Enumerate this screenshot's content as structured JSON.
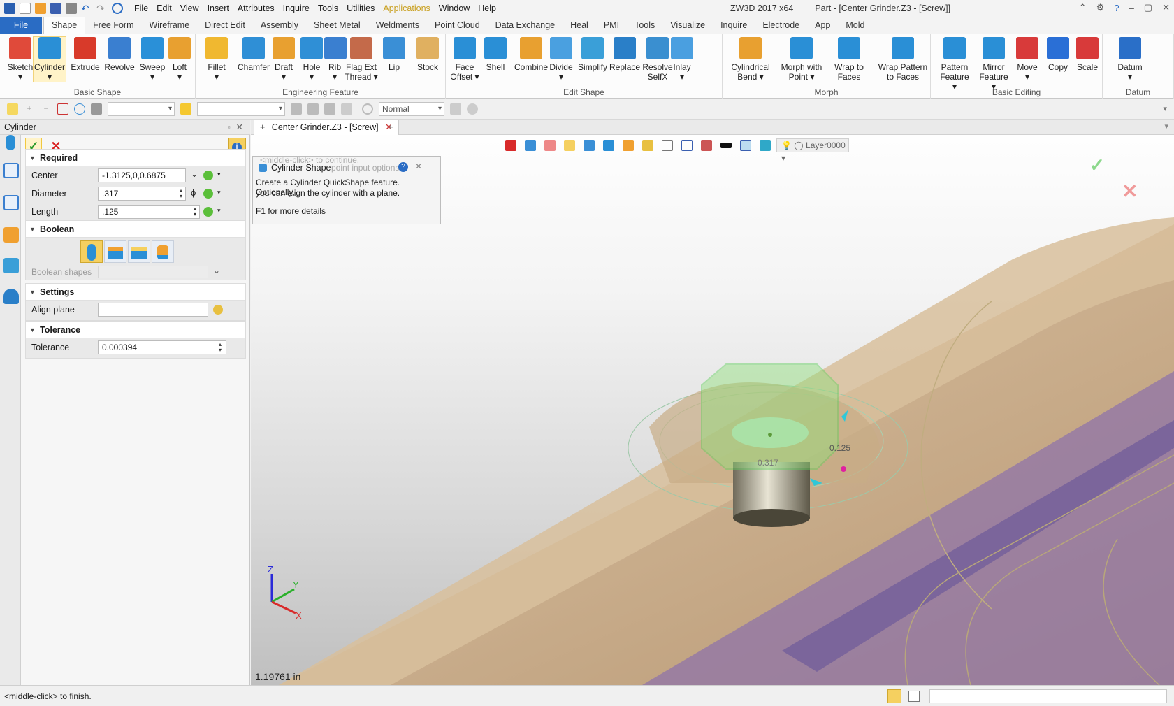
{
  "app": {
    "title": "ZW3D 2017  x64",
    "document_title": "Part - [Center Grinder.Z3 - [Screw]]"
  },
  "menu": [
    "File",
    "Edit",
    "View",
    "Insert",
    "Attributes",
    "Inquire",
    "Tools",
    "Utilities",
    "Applications",
    "Window",
    "Help"
  ],
  "ribbon_tabs": [
    "File",
    "Shape",
    "Free Form",
    "Wireframe",
    "Direct Edit",
    "Assembly",
    "Sheet Metal",
    "Weldments",
    "Point Cloud",
    "Data Exchange",
    "Heal",
    "PMI",
    "Tools",
    "Visualize",
    "Inquire",
    "Electrode",
    "App",
    "Mold"
  ],
  "ribbon_groups": [
    {
      "label": "Basic Shape",
      "buttons": [
        {
          "l1": "Sketch",
          "l2": "▾",
          "icon": "sketch-icon",
          "color": "#e04a3a"
        },
        {
          "l1": "Cylinder",
          "l2": "▾",
          "icon": "cylinder-icon",
          "color": "#2a8fd6"
        },
        {
          "l1": "Extrude",
          "l2": "",
          "icon": "extrude-icon",
          "color": "#d83a2a"
        },
        {
          "l1": "Revolve",
          "l2": "",
          "icon": "revolve-icon",
          "color": "#3a7fd0"
        },
        {
          "l1": "Sweep",
          "l2": "▾",
          "icon": "sweep-icon",
          "color": "#2a90d8"
        },
        {
          "l1": "Loft",
          "l2": "▾",
          "icon": "loft-icon",
          "color": "#e8a030"
        }
      ]
    },
    {
      "label": "Engineering Feature",
      "buttons": [
        {
          "l1": "Fillet",
          "l2": "▾",
          "icon": "fillet-icon",
          "color": "#f0b830"
        },
        {
          "l1": "Chamfer",
          "l2": "",
          "icon": "chamfer-icon",
          "color": "#2f8fd6"
        },
        {
          "l1": "Draft",
          "l2": "▾",
          "icon": "draft-icon",
          "color": "#e8a030"
        },
        {
          "l1": "Hole",
          "l2": "▾",
          "icon": "hole-icon",
          "color": "#2f8fd6"
        },
        {
          "l1": "Rib",
          "l2": "▾",
          "icon": "rib-icon",
          "color": "#3a7fd0"
        },
        {
          "l1": "Flag Ext",
          "l2": "Thread ▾",
          "icon": "thread-icon",
          "color": "#c46a4a"
        },
        {
          "l1": "Lip",
          "l2": "",
          "icon": "lip-icon",
          "color": "#3a8fd6"
        },
        {
          "l1": "Stock",
          "l2": "",
          "icon": "stock-icon",
          "color": "#e0b060"
        }
      ]
    },
    {
      "label": "Edit Shape",
      "buttons": [
        {
          "l1": "Face",
          "l2": "Offset ▾",
          "icon": "face-offset-icon",
          "color": "#2a8fd6"
        },
        {
          "l1": "Shell",
          "l2": "",
          "icon": "shell-icon",
          "color": "#2a8fd6"
        },
        {
          "l1": "Combine",
          "l2": "",
          "icon": "combine-icon",
          "color": "#e8a030"
        },
        {
          "l1": "Divide",
          "l2": "▾",
          "icon": "divide-icon",
          "color": "#4aa0e0"
        },
        {
          "l1": "Simplify",
          "l2": "",
          "icon": "simplify-icon",
          "color": "#3a9fd8"
        },
        {
          "l1": "Replace",
          "l2": "",
          "icon": "replace-icon",
          "color": "#2a7fc8"
        },
        {
          "l1": "Resolve",
          "l2": "SelfX",
          "icon": "resolve-selfx-icon",
          "color": "#3a8fd0"
        },
        {
          "l1": "Inlay",
          "l2": "▾",
          "icon": "inlay-icon",
          "color": "#4a9fe0"
        }
      ]
    },
    {
      "label": "Morph",
      "buttons": [
        {
          "l1": "Cylindrical",
          "l2": "Bend ▾",
          "icon": "cylindrical-bend-icon",
          "color": "#e8a030"
        },
        {
          "l1": "Morph with",
          "l2": "Point ▾",
          "icon": "morph-point-icon",
          "color": "#2a8fd6"
        },
        {
          "l1": "Wrap to",
          "l2": "Faces",
          "icon": "wrap-faces-icon",
          "color": "#2a8fd6"
        },
        {
          "l1": "Wrap Pattern",
          "l2": "to Faces",
          "icon": "wrap-pattern-icon",
          "color": "#2a8fd6"
        }
      ]
    },
    {
      "label": "Basic Editing",
      "buttons": [
        {
          "l1": "Pattern",
          "l2": "Feature ▾",
          "icon": "pattern-icon",
          "color": "#2a8fd6"
        },
        {
          "l1": "Mirror",
          "l2": "Feature ▾",
          "icon": "mirror-icon",
          "color": "#2a8fd6"
        },
        {
          "l1": "Move",
          "l2": "▾",
          "icon": "move-icon",
          "color": "#d83a3a"
        },
        {
          "l1": "Copy",
          "l2": "",
          "icon": "copy-icon",
          "color": "#2a6fd6"
        },
        {
          "l1": "Scale",
          "l2": "",
          "icon": "scale-icon",
          "color": "#d83a3a"
        }
      ]
    },
    {
      "label": "Datum",
      "buttons": [
        {
          "l1": "Datum",
          "l2": "▾",
          "icon": "datum-icon",
          "color": "#2a6fc8"
        }
      ]
    }
  ],
  "toolbar2": {
    "display_mode": "Normal"
  },
  "panel": {
    "title": "Cylinder",
    "required": {
      "header": "Required",
      "center_label": "Center",
      "center_value": "-1.3125,0,0.6875",
      "diameter_label": "Diameter",
      "diameter_value": ".317",
      "diameter_symbol": "ϕ",
      "length_label": "Length",
      "length_value": ".125"
    },
    "boolean": {
      "header": "Boolean",
      "shapes_label": "Boolean shapes"
    },
    "settings": {
      "header": "Settings",
      "align_label": "Align plane",
      "align_value": ""
    },
    "tolerance": {
      "header": "Tolerance",
      "label": "Tolerance",
      "value": "0.000394"
    }
  },
  "viewport": {
    "tab_label": "Center Grinder.Z3 - [Screw]",
    "layer": "Layer0000",
    "tooltip_title": "Cylinder Shape",
    "tooltip_ghost_1": "<middle-click> to continue.",
    "tooltip_ghost_2": "point input options",
    "tooltip_text_1": "Create a Cylinder QuickShape feature.  Optionally,",
    "tooltip_text_2": "you can align the cylinder with a plane.",
    "tooltip_f1": "F1 for more details",
    "dim_diameter": "0.317",
    "dim_length": "0.125",
    "measure": "1.19761 in",
    "axis_x": "X",
    "axis_y": "Y",
    "axis_z": "Z"
  },
  "status": {
    "message": "<middle-click> to finish."
  },
  "colors": {
    "accent": "#2a6cc4",
    "highlight": "#fff3c8",
    "part_body": "#c9a983",
    "part_shadow": "#8a6fa8",
    "preview": "#8fe07a"
  }
}
